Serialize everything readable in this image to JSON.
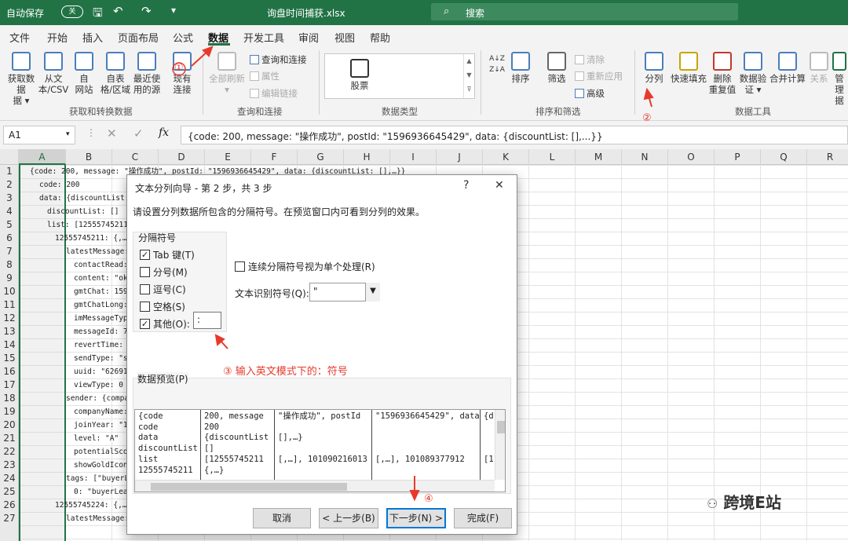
{
  "title_bar": {
    "autosave_label": "自动保存",
    "autosave_state": "关",
    "filename": "询盘时间捕获.xlsx",
    "search_placeholder": "搜索"
  },
  "tabs": [
    "文件",
    "开始",
    "插入",
    "页面布局",
    "公式",
    "数据",
    "开发工具",
    "审阅",
    "视图",
    "帮助"
  ],
  "active_tab": "数据",
  "ribbon": {
    "get_data": "获取数据",
    "get_data2": "据 ▾",
    "from_text": "从文",
    "from_text2": "本/CSV",
    "from_web": "自",
    "from_web2": "网站",
    "from_table": "自表",
    "from_table2": "格/区域",
    "recent": "最近使",
    "recent2": "用的源",
    "existing": "现有",
    "existing2": "连接",
    "group1": "获取和转换数据",
    "refresh_all": "全部刷新",
    "refresh_all2": "▾",
    "queries_connections": "查询和连接",
    "properties": "属性",
    "edit_links": "编辑链接",
    "group2": "查询和连接",
    "stocks": "股票",
    "group3": "数据类型",
    "sort_asc": "A↓Z",
    "sort": "排序",
    "filter": "筛选",
    "clear": "清除",
    "reapply": "重新应用",
    "advanced": "高级",
    "group4": "排序和筛选",
    "text_to_columns": "分列",
    "flash_fill": "快速填充",
    "remove_dup": "删除",
    "remove_dup2": "重复值",
    "validation": "数据验",
    "validation2": "证 ▾",
    "consolidate": "合并计算",
    "relationships": "关系",
    "manage": "管理",
    "manage2": "据",
    "group5": "数据工具"
  },
  "formula_bar": {
    "name_box": "A1",
    "formula": "{code: 200, message: \"操作成功\", postId: \"1596936645429\", data: {discountList: [],...}}"
  },
  "columns": [
    "A",
    "B",
    "C",
    "D",
    "E",
    "F",
    "G",
    "H",
    "I",
    "J",
    "K",
    "L",
    "M",
    "N",
    "O",
    "P",
    "Q",
    "R"
  ],
  "rows": [
    "1",
    "2",
    "3",
    "4",
    "5",
    "6",
    "7",
    "8",
    "9",
    "10",
    "11",
    "12",
    "13",
    "14",
    "15",
    "16",
    "17",
    "18",
    "19",
    "20",
    "21",
    "22",
    "23",
    "24",
    "25",
    "26",
    "27"
  ],
  "cells": [
    "{code: 200, message: \"操作成功\", postId: \"1596936645429\", data: {discountList: [],…}}",
    "code: 200",
    "data: {discountList: [],",
    "discountList: []",
    "list: [12555745211: {,…",
    "12555745211: {,…}",
    "latestMessage: {",
    "contactRead: t",
    "content: \"ok\"",
    "gmtChat: 1596",
    "gmtChatLong: 1",
    "imMessageType",
    "messageId: 700",
    "revertTime: 15",
    "sendType: \"sen",
    "uuid: \"626911",
    "viewType: 0",
    "sender: {company",
    "companyName:",
    "joinYear: \"1\"",
    "level: \"A\"",
    "potentialScor",
    "showGoldIcon:",
    "tags: [\"buyerLe",
    "0: \"buyerLead",
    "12555745224: {,…}",
    "latestMessage: {",
    "contactRead: t"
  ],
  "dialog": {
    "title": "文本分列向导 - 第 2 步，共 3 步",
    "help": "?",
    "close": "✕",
    "instruction": "请设置分列数据所包含的分隔符号。在预览窗口内可看到分列的效果。",
    "delimiters_title": "分隔符号",
    "tab": "Tab 键(T)",
    "semicolon": "分号(M)",
    "comma": "逗号(C)",
    "space": "空格(S)",
    "other": "其他(O):",
    "other_value": ":",
    "consecutive": "连续分隔符号视为单个处理(R)",
    "qualifier_label": "文本识别符号(Q):",
    "qualifier_value": "\"",
    "preview_title": "数据预览(P)",
    "preview_cols": [
      "{code\ncode\ndata\ndiscountList\nlist\n12555745211",
      "200, message\n200\n{discountList\n[]\n[12555745211\n{,…}",
      "\"操作成功\", postId\n\n[],…}\n\n[,…], 101090216013",
      "\"1596936645429\", data\n\n\n\n[,…], 101089377912",
      "{d\n\n\n\n[1"
    ],
    "cancel": "取消",
    "back": "< 上一步(B)",
    "next": "下一步(N) >",
    "finish": "完成(F)"
  },
  "annotations": {
    "a1": "①",
    "a2": "②",
    "a3": "③ 输入英文模式下的：符号",
    "a4": "④"
  },
  "watermark": "跨境E站"
}
